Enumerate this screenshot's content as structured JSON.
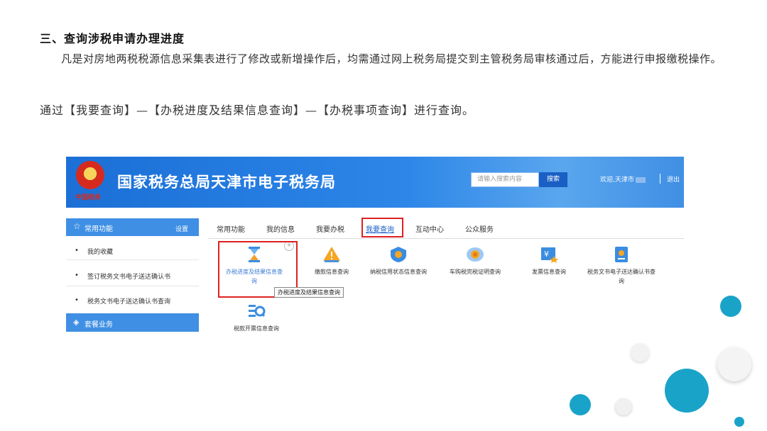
{
  "document": {
    "section_title": "三、查询涉税申请办理进度",
    "paragraph": "凡是对房地两税税源信息采集表进行了修改或新增操作后，均需通过网上税务局提交到主管税务局审核通过后，方能进行申报缴税操作。",
    "path_line": "通过【我要查询】—【办税进度及结果信息查询】—【办税事项查询】进行查询。"
  },
  "screenshot": {
    "header": {
      "emblem_text": "中国税务",
      "site_title": "国家税务总局天津市电子税务局",
      "search_placeholder": "请输入搜索内容",
      "search_button": "搜索",
      "welcome": "欢迎,天津市",
      "logout": "退出"
    },
    "sidebar": {
      "title": "常用功能",
      "settings": "设置",
      "items": [
        "我的收藏",
        "签订税务文书电子送达确认书",
        "税务文书电子送达确认书查询"
      ],
      "package": "套餐业务"
    },
    "tabs": [
      "常用功能",
      "我的信息",
      "我要办税",
      "我要查询",
      "互动中心",
      "公众服务"
    ],
    "active_tab": "我要查询",
    "tiles": {
      "t0": "办税进度及结果信息查询",
      "t1": "缴款信息查询",
      "t2": "纳税信用状态信息查询",
      "t3": "车购税完税证明查询",
      "t4": "发票信息查询",
      "t5": "税务文书电子送达确认书查询",
      "t6": "税款开票信息查询"
    },
    "tooltip": "办税进度及结果信息查询"
  },
  "colors": {
    "banner": "#2d86e8",
    "accent": "#1a5fc4",
    "highlight": "#e02020",
    "deco_teal": "#1aa3c8"
  },
  "icons": {
    "emblem": "tax-emblem-icon",
    "star": "star-icon",
    "layers": "layers-icon",
    "hourglass": "hourglass-icon",
    "warning": "warning-icon",
    "credit": "credit-shield-icon",
    "car": "car-tax-icon",
    "invoice": "invoice-icon",
    "document": "document-icon",
    "eq": "eq-search-icon"
  }
}
